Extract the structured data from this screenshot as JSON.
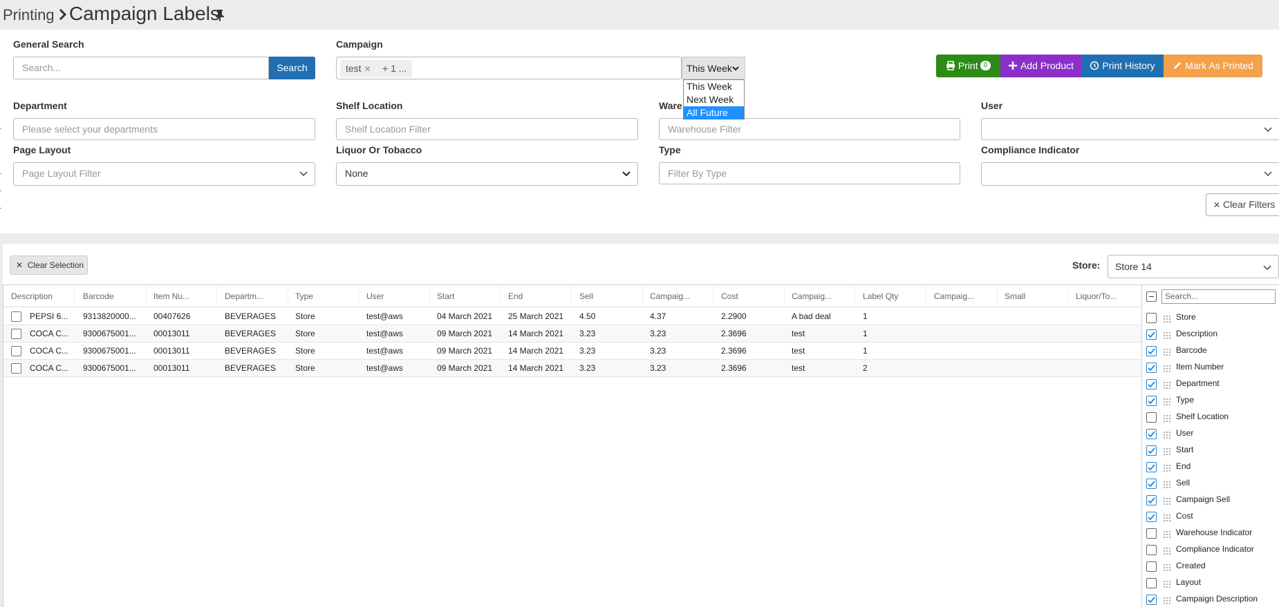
{
  "header": {
    "breadcrumb_parent": "Printing",
    "title": "Campaign Labels"
  },
  "filters": {
    "general_search": {
      "label": "General Search",
      "placeholder": "Search...",
      "button": "Search"
    },
    "campaign": {
      "label": "Campaign",
      "tags": [
        "test",
        "+ 1 ..."
      ]
    },
    "week_select": {
      "value": "This Week",
      "options": [
        "This Week",
        "Next Week",
        "All Future"
      ],
      "highlighted": "All Future"
    },
    "department": {
      "label": "Department",
      "placeholder": "Please select your departments"
    },
    "shelf_location": {
      "label": "Shelf Location",
      "placeholder": "Shelf Location Filter"
    },
    "warehouse": {
      "label": "Ware",
      "placeholder": "Warehouse Filter"
    },
    "user": {
      "label": "User",
      "value": ""
    },
    "page_layout": {
      "label": "Page Layout",
      "placeholder": "Page Layout Filter"
    },
    "liquor_tobacco": {
      "label": "Liquor Or Tobacco",
      "value": "None"
    },
    "type": {
      "label": "Type",
      "placeholder": "Filter By Type"
    },
    "compliance": {
      "label": "Compliance Indicator",
      "value": ""
    },
    "clear_filters": "Clear Filters"
  },
  "actions": {
    "print": "Print",
    "print_count": "0",
    "add_product": "Add Product",
    "print_history": "Print History",
    "mark_printed": "Mark As Printed",
    "colors": {
      "print": "#2d8a16",
      "add_product": "#8b2fc9",
      "print_history": "#1f6fb2",
      "mark_printed": "#f5a04b"
    }
  },
  "grid": {
    "clear_selection": "Clear Selection",
    "store_label": "Store:",
    "store_value": "Store 14",
    "columns": [
      "Description",
      "Barcode",
      "Item Nu...",
      "Departm...",
      "Type",
      "User",
      "Start",
      "End",
      "Sell",
      "Campaig...",
      "Cost",
      "Campaig...",
      "Label Qty",
      "Campaig...",
      "Small",
      "Liquor/To..."
    ],
    "rows": [
      [
        "PEPSI 6...",
        "9313820000...",
        "00407626",
        "BEVERAGES",
        "Store",
        "test@aws",
        "04 March 2021",
        "25 March 2021",
        "4.50",
        "4.37",
        "2.2900",
        "A bad deal",
        "1",
        "",
        "",
        ""
      ],
      [
        "COCA C...",
        "9300675001...",
        "00013011",
        "BEVERAGES",
        "Store",
        "test@aws",
        "09 March 2021",
        "14 March 2021",
        "3.23",
        "3.23",
        "2.3696",
        "test",
        "1",
        "",
        "",
        ""
      ],
      [
        "COCA C...",
        "9300675001...",
        "00013011",
        "BEVERAGES",
        "Store",
        "test@aws",
        "09 March 2021",
        "14 March 2021",
        "3.23",
        "3.23",
        "2.3696",
        "test",
        "1",
        "",
        "",
        ""
      ],
      [
        "COCA C...",
        "9300675001...",
        "00013011",
        "BEVERAGES",
        "Store",
        "test@aws",
        "09 March 2021",
        "14 March 2021",
        "3.23",
        "3.23",
        "2.3696",
        "test",
        "2",
        "",
        "",
        ""
      ]
    ]
  },
  "column_chooser": {
    "search_placeholder": "Search...",
    "items": [
      {
        "label": "Store",
        "checked": false
      },
      {
        "label": "Description",
        "checked": true
      },
      {
        "label": "Barcode",
        "checked": true
      },
      {
        "label": "Item Number",
        "checked": true
      },
      {
        "label": "Department",
        "checked": true
      },
      {
        "label": "Type",
        "checked": true
      },
      {
        "label": "Shelf Location",
        "checked": false
      },
      {
        "label": "User",
        "checked": true
      },
      {
        "label": "Start",
        "checked": true
      },
      {
        "label": "End",
        "checked": true
      },
      {
        "label": "Sell",
        "checked": true
      },
      {
        "label": "Campaign Sell",
        "checked": true
      },
      {
        "label": "Cost",
        "checked": true
      },
      {
        "label": "Warehouse Indicator",
        "checked": false
      },
      {
        "label": "Compliance Indicator",
        "checked": false
      },
      {
        "label": "Created",
        "checked": false
      },
      {
        "label": "Layout",
        "checked": false
      },
      {
        "label": "Campaign Description",
        "checked": true
      }
    ]
  }
}
